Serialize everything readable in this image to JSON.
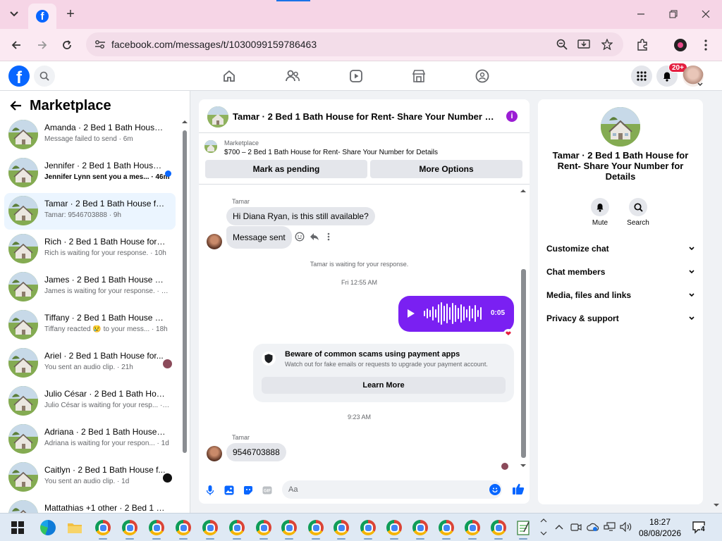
{
  "browser": {
    "url": "facebook.com/messages/t/1030099159786463",
    "tab_favicon": "facebook-icon",
    "new_tab_glyph": "+"
  },
  "facebook": {
    "logo_letter": "f",
    "notification_badge": "20+",
    "nav_icons": [
      "home-icon",
      "friends-icon",
      "video-icon",
      "marketplace-icon",
      "groups-icon"
    ]
  },
  "left_panel": {
    "title": "Marketplace",
    "conversations": [
      {
        "name": "Amanda · 2 Bed 1 Bath House f...",
        "sub": "Message failed to send · 6m",
        "bold": false,
        "active": false,
        "indicator": ""
      },
      {
        "name": "Jennifer · 2 Bed 1 Bath House ...",
        "sub": "Jennifer Lynn sent you a mes... · 46m",
        "bold": true,
        "active": false,
        "indicator": "unread"
      },
      {
        "name": "Tamar · 2 Bed 1 Bath House for ...",
        "sub": "Tamar: 9546703888 · 9h",
        "bold": false,
        "active": true,
        "indicator": ""
      },
      {
        "name": "Rich · 2 Bed 1 Bath House for R...",
        "sub": "Rich is waiting for your response. · 10h",
        "bold": false,
        "active": false,
        "indicator": ""
      },
      {
        "name": "James · 2 Bed 1 Bath House for ...",
        "sub": "James is waiting for your response. · 17h",
        "bold": false,
        "active": false,
        "indicator": ""
      },
      {
        "name": "Tiffany · 2 Bed 1 Bath House for...",
        "sub": "Tiffany reacted 😢 to your mess... · 18h",
        "bold": false,
        "active": false,
        "indicator": ""
      },
      {
        "name": "Ariel · 2 Bed 1 Bath House for...",
        "sub": "You sent an audio clip. · 21h",
        "bold": false,
        "active": false,
        "indicator": "avatar"
      },
      {
        "name": "Julio César · 2 Bed 1 Bath House...",
        "sub": "Julio César is waiting for your resp... · 1d",
        "bold": false,
        "active": false,
        "indicator": ""
      },
      {
        "name": "Adriana · 2 Bed 1 Bath House fo...",
        "sub": "Adriana is waiting for your respon... · 1d",
        "bold": false,
        "active": false,
        "indicator": ""
      },
      {
        "name": "Caitlyn · 2 Bed 1 Bath House f...",
        "sub": "You sent an audio clip. · 1d",
        "bold": false,
        "active": false,
        "indicator": "avatar-dark"
      },
      {
        "name": "Mattathias +1 other · 2 Bed 1 Ba...",
        "sub": "",
        "bold": false,
        "active": false,
        "indicator": ""
      }
    ]
  },
  "chat": {
    "header_title": "Tamar · 2 Bed 1 Bath House for Rent- Share Your Number for D...",
    "info_glyph": "i",
    "listing_kicker": "Marketplace",
    "listing_title": "$700 – 2 Bed 1 Bath House for Rent- Share Your Number for Details",
    "mark_pending_label": "Mark as pending",
    "more_options_label": "More Options",
    "sender_name_1": "Tamar",
    "message_1": "Hi Diana Ryan, is this still available?",
    "message_2": "Message sent",
    "waiting_note": "Tamar is waiting for your response.",
    "timestamp_1": "Fri 12:55 AM",
    "audio_duration": "0:05",
    "reaction": "❤",
    "scam_title": "Beware of common scams using payment apps",
    "scam_body": "Watch out for fake emails or requests to upgrade your payment account.",
    "learn_more_label": "Learn More",
    "timestamp_2": "9:23 AM",
    "sender_name_2": "Tamar",
    "message_3": "9546703888",
    "composer_placeholder": "Aa"
  },
  "right_panel": {
    "title": "Tamar · 2 Bed 1 Bath House for Rent- Share Your Number for Details",
    "mute_label": "Mute",
    "search_label": "Search",
    "sections": [
      "Customize chat",
      "Chat members",
      "Media, files and links",
      "Privacy & support"
    ]
  },
  "taskbar": {
    "time": "18:27",
    "date": "08/08/2026",
    "notification_count": "4"
  },
  "colors": {
    "facebook_blue": "#0866ff",
    "messenger_purple": "#7a20f2",
    "tab_strip": "#f6d5e6",
    "badge_red": "#e41e3f"
  }
}
